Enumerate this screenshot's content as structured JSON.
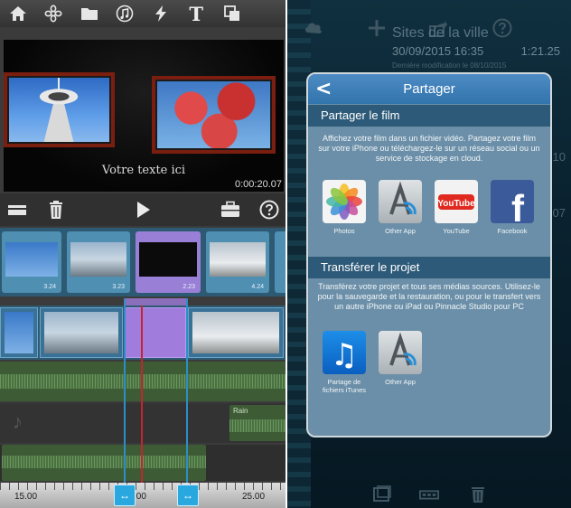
{
  "left": {
    "toolbar": {
      "icons": [
        "home-icon",
        "theme-flower-icon",
        "folder-icon",
        "music-icon",
        "effects-lightning-icon",
        "title-text-icon",
        "overlay-icon"
      ],
      "title_glyph": "T"
    },
    "preview": {
      "caption": "Votre texte ici",
      "timecode": "0:00:20.07"
    },
    "controls": [
      "split-clip-icon",
      "trash-icon",
      "play-icon",
      "toolbox-icon",
      "help-icon"
    ],
    "clips": [
      {
        "duration": "3.24"
      },
      {
        "duration": "3.23"
      },
      {
        "duration": "2.23",
        "selected": true
      },
      {
        "duration": "4.24"
      }
    ],
    "audio_clip_label": "Rain",
    "ruler": {
      "labels": [
        "15.00",
        ".00",
        "25.00"
      ],
      "handle_glyph": "↔"
    }
  },
  "right": {
    "background": {
      "project_title": "Sites de la ville",
      "date": "30/09/2015 16:35",
      "duration": "1:21.25",
      "modified": "Dernière modification le 08/10/2015",
      "side_values": [
        "10",
        "07"
      ]
    },
    "dialog": {
      "back_glyph": "<",
      "title": "Partager",
      "section_film": {
        "heading": "Partager le film",
        "description": "Affichez votre film dans un fichier vidéo. Partagez votre film sur votre iPhone ou téléchargez-le sur un réseau social ou un service de stockage en cloud.",
        "targets": [
          {
            "label": "Photos",
            "icon": "photos-icon"
          },
          {
            "label": "Other App",
            "icon": "other-app-icon"
          },
          {
            "label": "YouTube",
            "icon": "youtube-icon"
          },
          {
            "label": "Facebook",
            "icon": "facebook-icon"
          }
        ]
      },
      "section_project": {
        "heading": "Transférer le projet",
        "description": "Transférez votre projet et tous ses médias sources. Utilisez-le pour la sauvegarde et la restauration, ou pour le transfert vers un autre iPhone ou iPad ou Pinnacle Studio pour PC",
        "targets": [
          {
            "label": "Partage de fichiers iTunes",
            "icon": "itunes-icon"
          },
          {
            "label": "Other App",
            "icon": "other-app-icon"
          }
        ]
      }
    },
    "youtube_text": "YouTube",
    "facebook_glyph": "f",
    "itunes_glyph": "♫",
    "colors": {
      "dialog_header": "#3d80bb",
      "section_header": "#2d5a78",
      "dialog_body": "#6b8fa8",
      "timeline_purple": "#a07ddc",
      "playhead_red": "#c8232c",
      "trim_blue": "#29a8e0"
    }
  }
}
